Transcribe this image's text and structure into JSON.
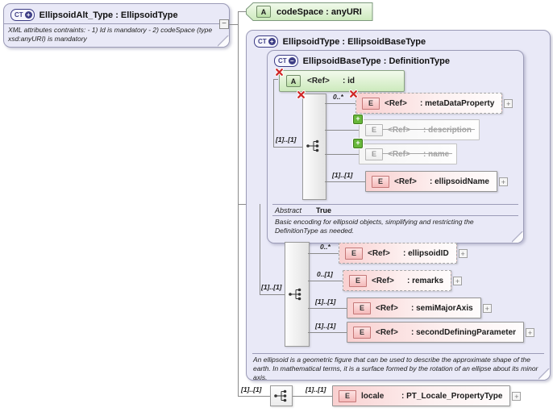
{
  "icons": {
    "complex_type": "CT",
    "attribute": "A",
    "element": "E",
    "expand_symbol": "+",
    "collapse_symbol": "−",
    "add_symbol": "+"
  },
  "root_box": {
    "title": "EllipsoidAlt_Type : EllipsoidType",
    "note": "XML attributes contraints: - 1) Id is mandatory - 2) codeSpace (type xsd:anyURI) is mandatory"
  },
  "codespace_attr": {
    "label": "codeSpace : anyURI"
  },
  "outer_box": {
    "title": "EllipsoidType : EllipsoidBaseType",
    "annotation": "An ellipsoid is a geometric figure that can be used to describe the approximate shape of the earth. In mathematical terms, it is a surface formed by the rotation of an ellipse about its minor axis."
  },
  "inner_box": {
    "title": "EllipsoidBaseType : DefinitionType",
    "id_attr": {
      "ref": "<Ref>",
      "name": ": id"
    },
    "sequence_occurrence": "[1]..[1]",
    "elements": [
      {
        "ref": "<Ref>",
        "name": ": metaDataProperty",
        "occurrence": "0..*"
      },
      {
        "ref": "<Ref>",
        "name": ": description",
        "occurrence": ""
      },
      {
        "ref": "<Ref>",
        "name": ": name",
        "occurrence": ""
      },
      {
        "ref": "<Ref>",
        "name": ": ellipsoidName",
        "occurrence": "[1]..[1]"
      }
    ],
    "abstract_label": "Abstract",
    "abstract_value": "True",
    "annotation": "Basic encoding for ellipsoid objects, simplifying and restricting the DefinitionType as needed."
  },
  "outer_sequence_occurrence": "[1]..[1]",
  "outer_elements": [
    {
      "ref": "<Ref>",
      "name": ": ellipsoidID",
      "occurrence": "0..*"
    },
    {
      "ref": "<Ref>",
      "name": ": remarks",
      "occurrence": "0..[1]"
    },
    {
      "ref": "<Ref>",
      "name": ": semiMajorAxis",
      "occurrence": "[1]..[1]"
    },
    {
      "ref": "<Ref>",
      "name": ": secondDefiningParameter",
      "occurrence": "[1]..[1]"
    }
  ],
  "locale_row": {
    "occurrence_left": "[1]..[1]",
    "occurrence_right": "[1]..[1]",
    "label": "locale",
    "name": ": PT_Locale_PropertyType"
  }
}
